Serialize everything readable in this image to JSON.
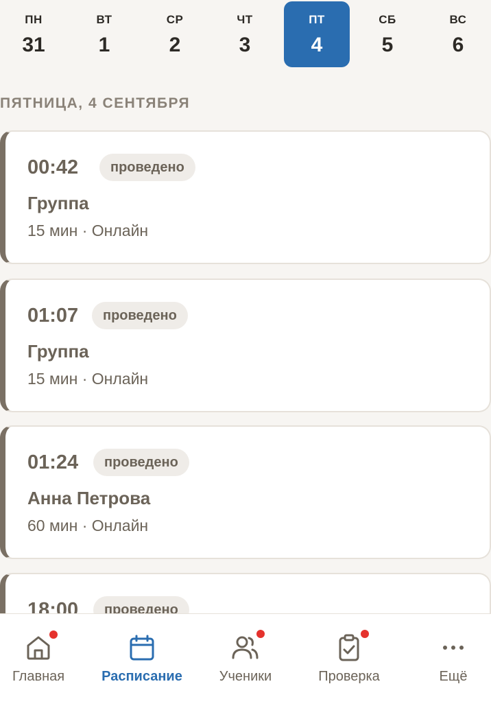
{
  "week": [
    {
      "name": "ПН",
      "num": "31",
      "active": false
    },
    {
      "name": "ВТ",
      "num": "1",
      "active": false
    },
    {
      "name": "СР",
      "num": "2",
      "active": false
    },
    {
      "name": "ЧТ",
      "num": "3",
      "active": false
    },
    {
      "name": "ПТ",
      "num": "4",
      "active": true
    },
    {
      "name": "СБ",
      "num": "5",
      "active": false
    },
    {
      "name": "ВС",
      "num": "6",
      "active": false
    }
  ],
  "date_heading": "ПЯТНИЦА, 4 СЕНТЯБРЯ",
  "lessons": [
    {
      "time": "00:42",
      "status": "проведено",
      "name": "Группа",
      "meta": "15 мин · Онлайн"
    },
    {
      "time": "01:07",
      "status": "проведено",
      "name": "Группа",
      "meta": "15 мин · Онлайн"
    },
    {
      "time": "01:24",
      "status": "проведено",
      "name": "Анна Петрова",
      "meta": "60 мин · Онлайн"
    },
    {
      "time": "18:00",
      "status": "проведено",
      "name": "",
      "meta": ""
    }
  ],
  "nav": [
    {
      "label": "Главная",
      "icon": "home-icon",
      "active": false,
      "dot": true
    },
    {
      "label": "Расписание",
      "icon": "calendar-icon",
      "active": true,
      "dot": false
    },
    {
      "label": "Ученики",
      "icon": "users-icon",
      "active": false,
      "dot": true
    },
    {
      "label": "Проверка",
      "icon": "clipboard-check-icon",
      "active": false,
      "dot": true
    },
    {
      "label": "Ещё",
      "icon": "more-icon",
      "active": false,
      "dot": false
    }
  ],
  "colors": {
    "accent": "#2a6db0",
    "notification_dot": "#e5322d",
    "card_stripe": "#7a7064"
  }
}
